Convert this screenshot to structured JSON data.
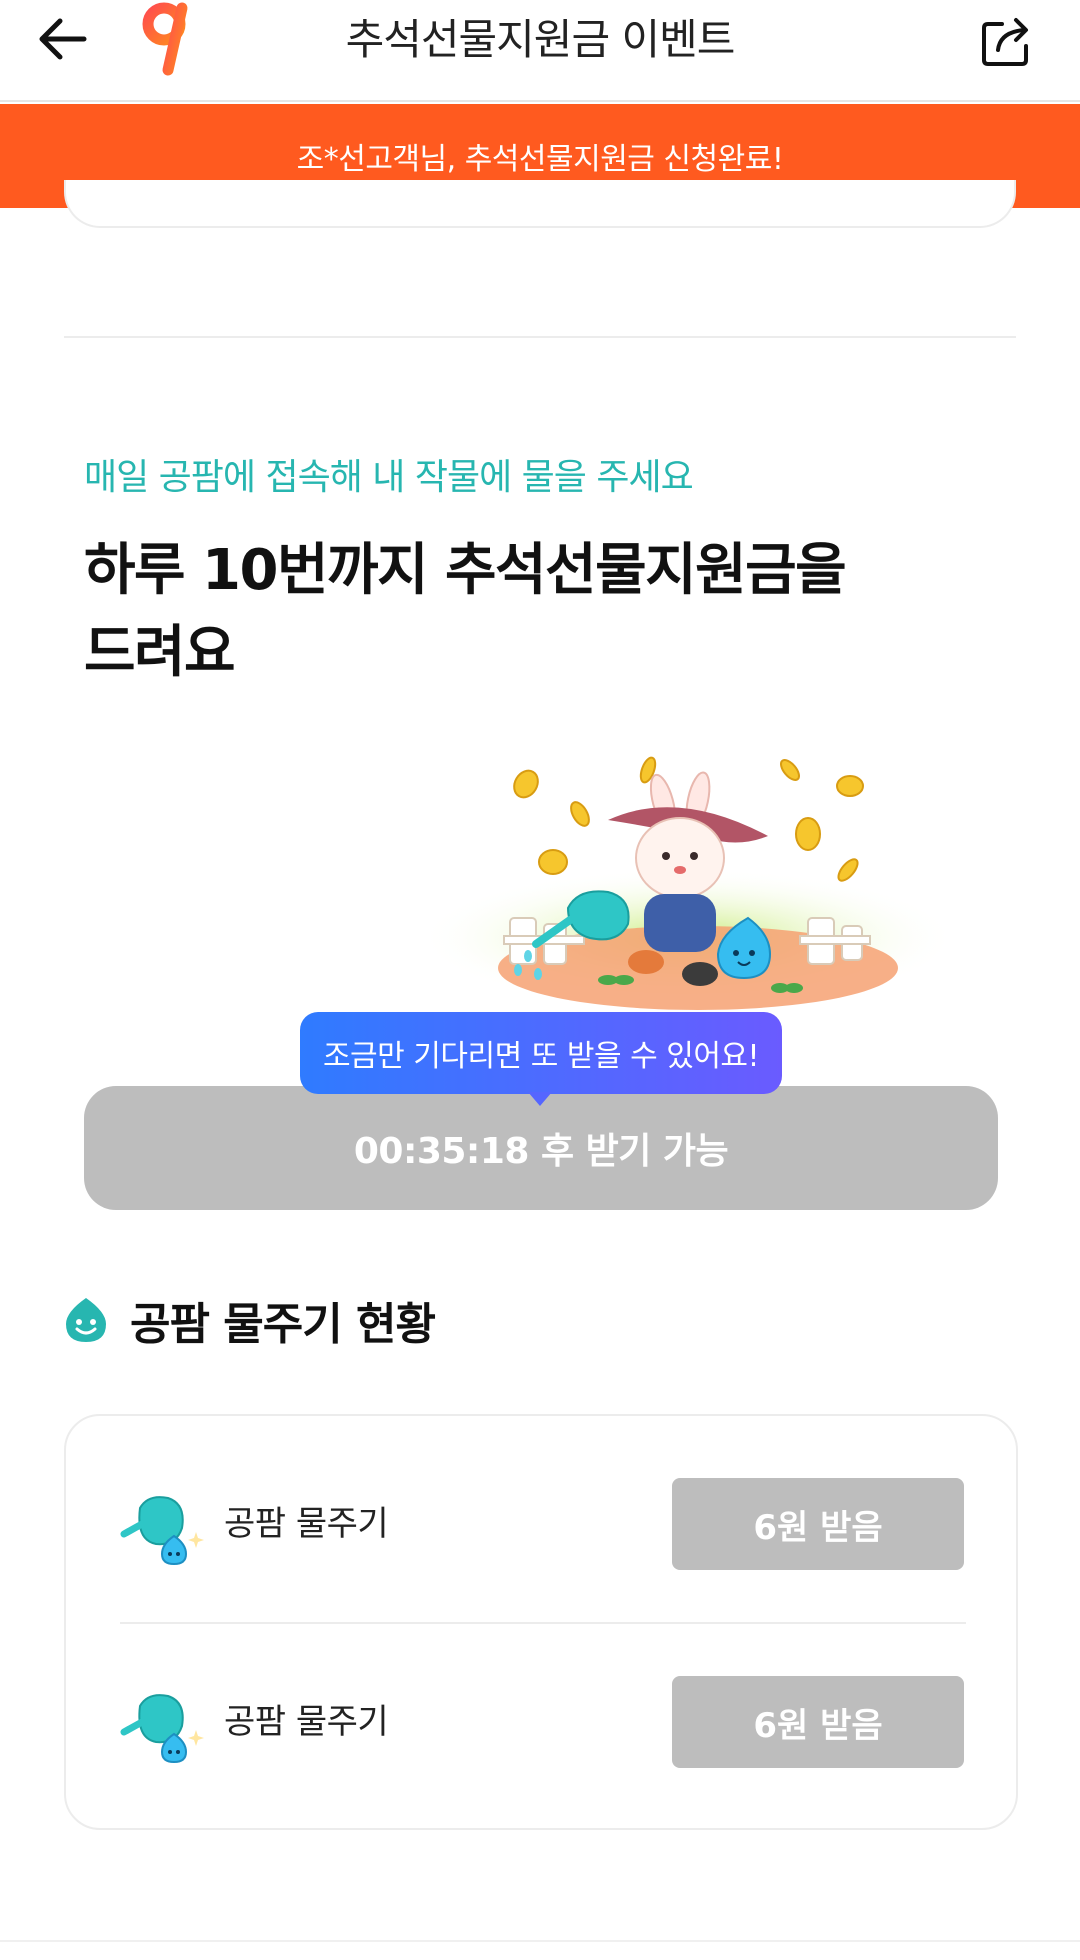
{
  "appbar": {
    "title": "추석선물지원금 이벤트",
    "back_icon": "arrow-left-icon",
    "logo_icon": "gongpam-logo-icon",
    "share_icon": "share-icon"
  },
  "banner": {
    "text": "조*선고객님, 추석선물지원금 신청완료!"
  },
  "event": {
    "subtitle": "매일 공팜에 접속해 내 작물에 물을 주세요",
    "headline": "하루 10번까지 추석선물지원금을\n드려요"
  },
  "tooltip": {
    "text": "조금만 기다리면 또 받을 수 있어요!"
  },
  "timer_button": {
    "label": "00:35:18 후 받기 가능"
  },
  "status": {
    "title": "공팜 물주기 현황",
    "icon": "smile-drop-icon",
    "rows": [
      {
        "label": "공팜 물주기",
        "button": "6원 받음",
        "icon": "watering-can-icon"
      },
      {
        "label": "공팜 물주기",
        "button": "6원 받음",
        "icon": "watering-can-icon"
      }
    ]
  },
  "colors": {
    "banner": "#ff5a1f",
    "accent_teal": "#27b6b0",
    "disabled_gray": "#bdbdbd",
    "tooltip_start": "#2f7bff",
    "tooltip_end": "#6a5bff"
  }
}
